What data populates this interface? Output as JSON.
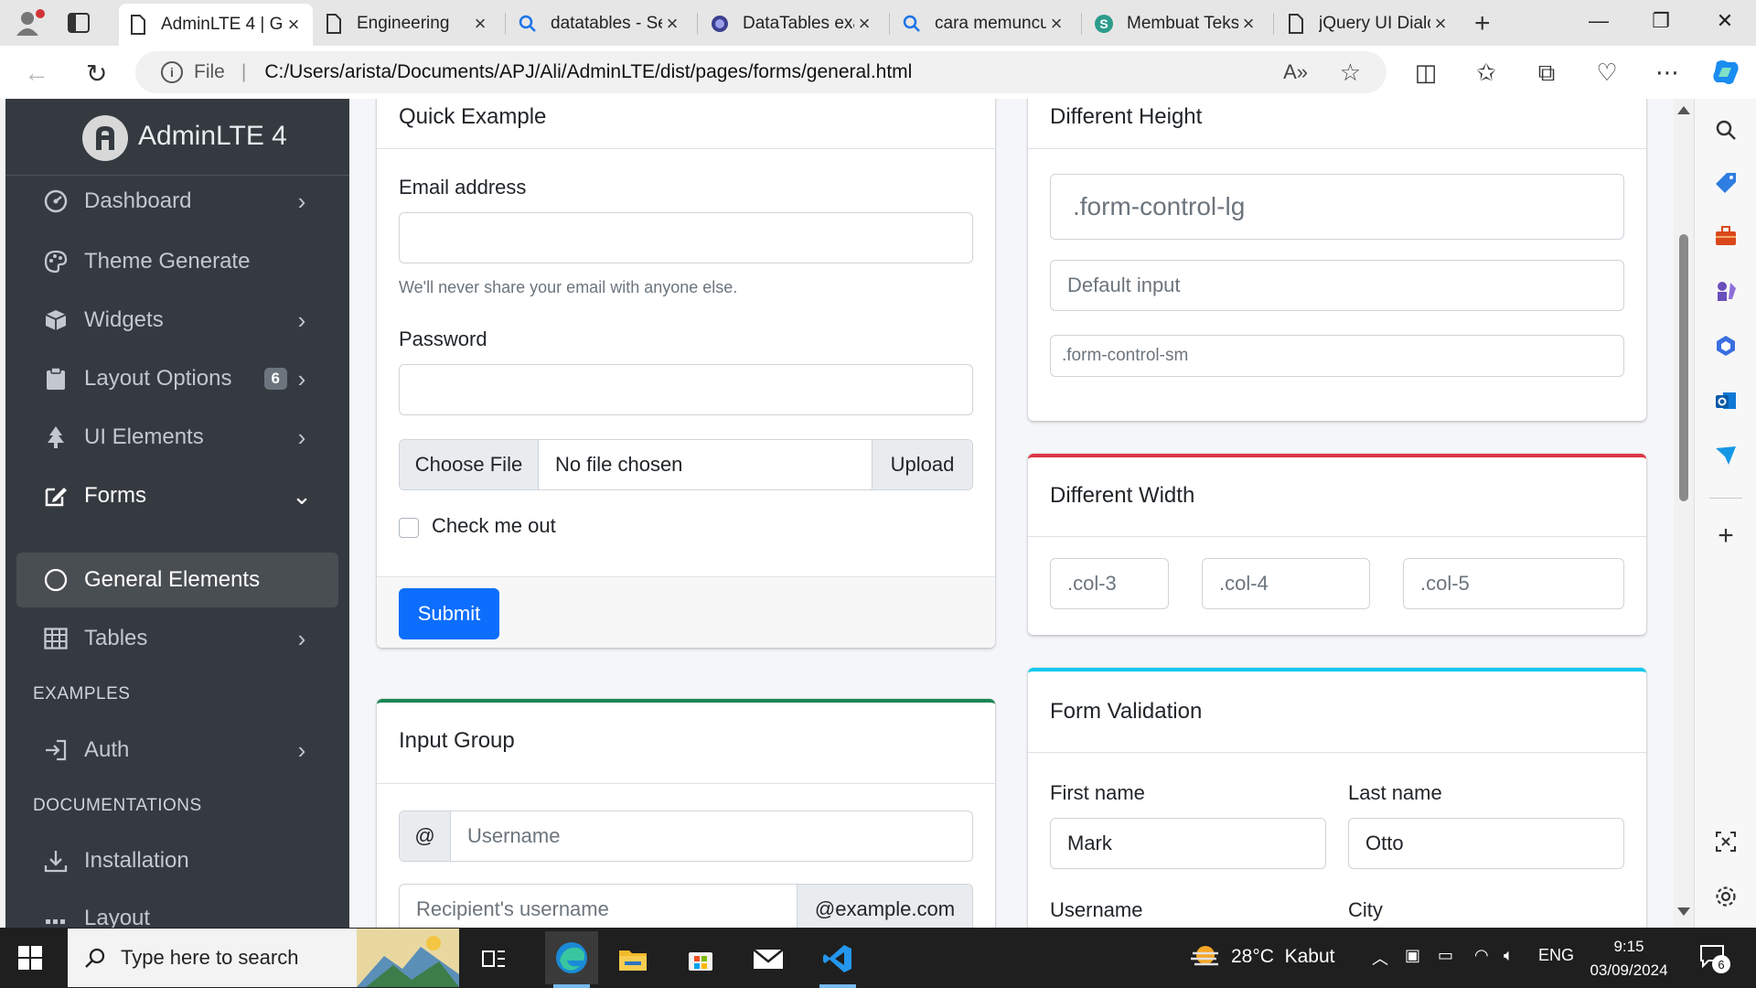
{
  "browser": {
    "tabs": [
      {
        "title": "AdminLTE 4 | G",
        "icon": "page-icon",
        "active": true
      },
      {
        "title": "Engineering",
        "icon": "page-icon"
      },
      {
        "title": "datatables - Se",
        "icon": "search-icon"
      },
      {
        "title": "DataTables exa",
        "icon": "datatables-icon"
      },
      {
        "title": "cara memuncu",
        "icon": "search-icon"
      },
      {
        "title": "Membuat Teks",
        "icon": "site-s-icon"
      },
      {
        "title": "jQuery UI Dialo",
        "icon": "page-icon"
      }
    ],
    "new_tab": "+",
    "scheme": "File",
    "url": "C:/Users/arista/Documents/APJ/Ali/AdminLTE/dist/pages/forms/general.html"
  },
  "sidebar": {
    "brand": "AdminLTE 4",
    "items": [
      {
        "label": "Dashboard",
        "icon": "dashboard-icon",
        "arrow": "right"
      },
      {
        "label": "Theme Generate",
        "icon": "palette-icon",
        "arrow": ""
      },
      {
        "label": "Widgets",
        "icon": "box-icon",
        "arrow": "right"
      },
      {
        "label": "Layout Options",
        "icon": "clipboard-icon",
        "arrow": "right",
        "badge": "6"
      },
      {
        "label": "UI Elements",
        "icon": "tree-icon",
        "arrow": "right"
      },
      {
        "label": "Forms",
        "icon": "pencil-square-icon",
        "arrow": "down"
      },
      {
        "label": "General Elements",
        "icon": "circle-icon",
        "arrow": "",
        "active": true
      },
      {
        "label": "Tables",
        "icon": "table-icon",
        "arrow": "right"
      }
    ],
    "header_examples": "EXAMPLES",
    "auth": {
      "label": "Auth",
      "icon": "login-icon"
    },
    "header_docs": "DOCUMENTATIONS",
    "installation": {
      "label": "Installation",
      "icon": "download-icon"
    },
    "layout": {
      "label": "Layout",
      "icon": "grid-icon"
    }
  },
  "quick_example": {
    "title": "Quick Example",
    "email_label": "Email address",
    "email_value": "",
    "email_help": "We'll never share your email with anyone else.",
    "password_label": "Password",
    "password_value": "",
    "choose_file": "Choose File",
    "no_file": "No file chosen",
    "upload": "Upload",
    "check_label": "Check me out",
    "submit": "Submit"
  },
  "input_group": {
    "title": "Input Group",
    "at": "@",
    "username_placeholder": "Username",
    "recipient_placeholder": "Recipient's username",
    "domain": "@example.com"
  },
  "different_height": {
    "title": "Different Height",
    "lg": ".form-control-lg",
    "default": "Default input",
    "sm": ".form-control-sm"
  },
  "different_width": {
    "title": "Different Width",
    "col3": ".col-3",
    "col4": ".col-4",
    "col5": ".col-5"
  },
  "form_validation": {
    "title": "Form Validation",
    "first_name_label": "First name",
    "first_name_value": "Mark",
    "last_name_label": "Last name",
    "last_name_value": "Otto",
    "username_label": "Username",
    "city_label": "City"
  },
  "colors": {
    "sidebar_bg": "#343a40",
    "primary": "#0d6efd",
    "success": "#198754",
    "danger": "#dc3545",
    "info": "#0dcaf0"
  },
  "taskbar": {
    "search_placeholder": "Type here to search",
    "weather": "28°C  Kabut",
    "lang": "ENG",
    "time": "9:15",
    "date": "03/09/2024",
    "notifications": "6"
  }
}
